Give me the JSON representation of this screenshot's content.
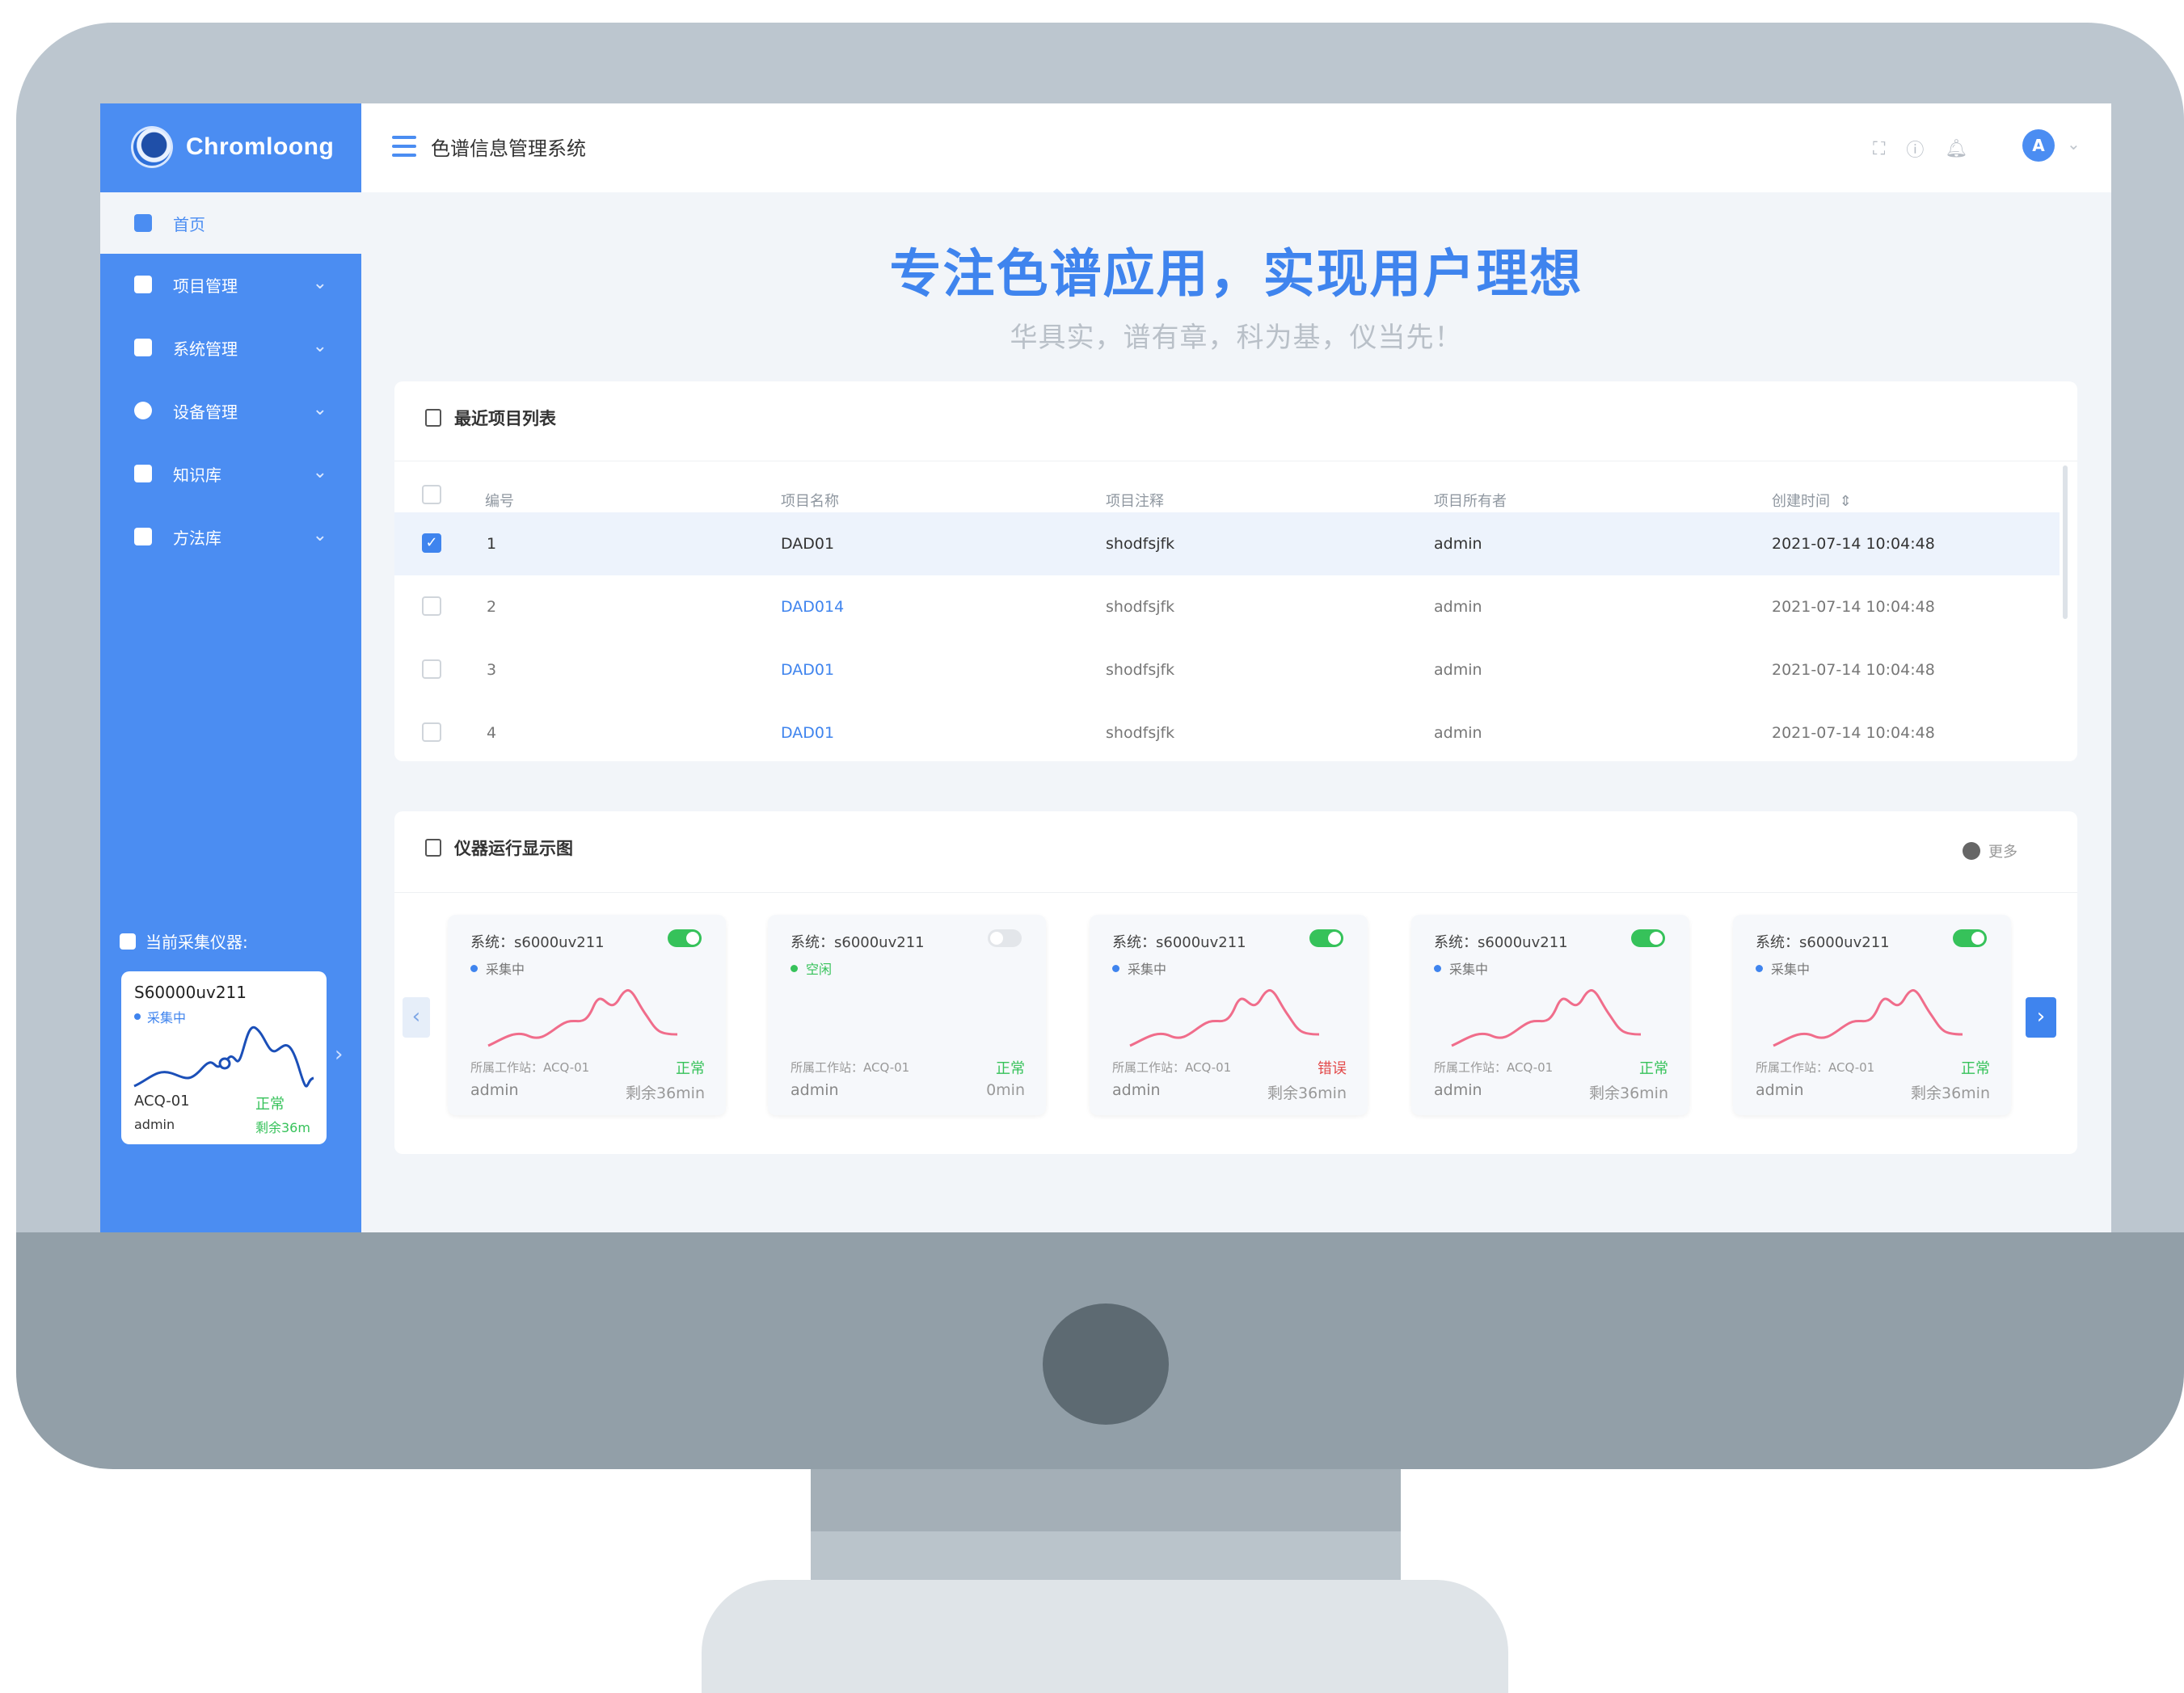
{
  "brand": {
    "name": "Chromloong"
  },
  "header": {
    "app_title": "色谱信息管理系统",
    "avatar_letter": "A"
  },
  "sidebar": {
    "home_label": "首页",
    "items": [
      {
        "label": "项目管理"
      },
      {
        "label": "系统管理"
      },
      {
        "label": "设备管理"
      },
      {
        "label": "知识库"
      },
      {
        "label": "方法库"
      }
    ],
    "acq_title": "当前采集仪器:",
    "acq_card": {
      "system": "S60000uv211",
      "status": "采集中",
      "workstation": "ACQ-01",
      "state": "正常",
      "user": "admin",
      "remaining": "剩余36m"
    }
  },
  "hero": {
    "title": "专注色谱应用，实现用户理想",
    "subtitle": "华具实，谱有章，科为基，仪当先！"
  },
  "projects": {
    "title": "最近项目列表",
    "columns": [
      "编号",
      "项目名称",
      "项目注释",
      "项目所有者",
      "创建时间"
    ],
    "rows": [
      {
        "no": "1",
        "name": "DAD01",
        "note": "shodfsjfk",
        "owner": "admin",
        "created": "2021-07-14 10:04:48",
        "selected": true
      },
      {
        "no": "2",
        "name": "DAD014",
        "note": "shodfsjfk",
        "owner": "admin",
        "created": "2021-07-14 10:04:48",
        "selected": false
      },
      {
        "no": "3",
        "name": "DAD01",
        "note": "shodfsjfk",
        "owner": "admin",
        "created": "2021-07-14 10:04:48",
        "selected": false
      },
      {
        "no": "4",
        "name": "DAD01",
        "note": "shodfsjfk",
        "owner": "admin",
        "created": "2021-07-14 10:04:48",
        "selected": false
      }
    ]
  },
  "instruments": {
    "title": "仪器运行显示图",
    "more_label": "更多",
    "cards": [
      {
        "system": "系统：s6000uv211",
        "status": "采集中",
        "workstation": "所属工作站：ACQ-01",
        "state": "正常",
        "user": "admin",
        "remaining": "剩余36min",
        "running": true
      },
      {
        "system": "系统：s6000uv211",
        "status": "空闲",
        "workstation": "所属工作站：ACQ-01",
        "state": "正常",
        "user": "admin",
        "remaining": "0min",
        "running": false
      },
      {
        "system": "系统：s6000uv211",
        "status": "采集中",
        "workstation": "所属工作站：ACQ-01",
        "state": "错误",
        "user": "admin",
        "remaining": "剩余36min",
        "running": true
      },
      {
        "system": "系统：s6000uv211",
        "status": "采集中",
        "workstation": "所属工作站：ACQ-01",
        "state": "正常",
        "user": "admin",
        "remaining": "剩余36min",
        "running": true
      },
      {
        "system": "系统：s6000uv211",
        "status": "采集中",
        "workstation": "所属工作站：ACQ-01",
        "state": "正常",
        "user": "admin",
        "remaining": "剩余36min",
        "running": true
      }
    ]
  },
  "colors": {
    "primary": "#4b8df2",
    "success": "#36c25a",
    "error": "#e34b4b"
  },
  "icons": [
    "home-icon",
    "project-icon",
    "system-icon",
    "device-icon",
    "knowledge-icon",
    "method-icon",
    "menu-icon",
    "fullscreen-icon",
    "help-icon",
    "bell-icon"
  ]
}
